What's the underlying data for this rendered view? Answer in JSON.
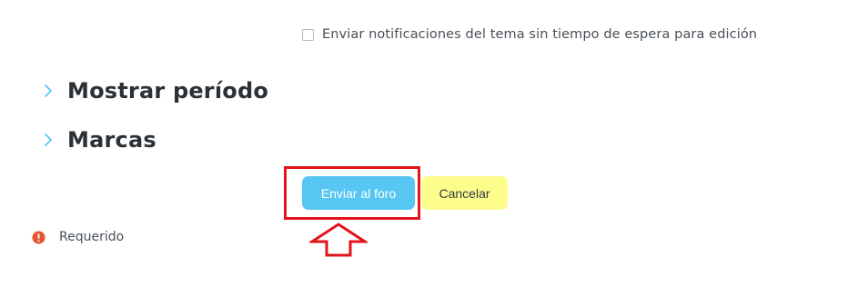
{
  "form": {
    "notify_checkbox": {
      "label": "Enviar notificaciones del tema sin tiempo de espera para edición",
      "checked": false
    },
    "sections": [
      {
        "title": "Mostrar período",
        "icon": "chevron-right-icon",
        "expanded": false
      },
      {
        "title": "Marcas",
        "icon": "chevron-right-icon",
        "expanded": false
      }
    ],
    "buttons": {
      "submit_label": "Enviar al foro",
      "cancel_label": "Cancelar"
    },
    "required_note": {
      "icon": "exclamation-circle-icon",
      "label": "Requerido"
    }
  },
  "annotations": {
    "highlight_color": "#e3141b",
    "arrow_icon": "up-arrow-icon"
  },
  "colors": {
    "primary_button": "#57c6f2",
    "cancel_button": "#fdfd8c",
    "chevron": "#57c6f2",
    "required_icon": "#e4572e"
  }
}
